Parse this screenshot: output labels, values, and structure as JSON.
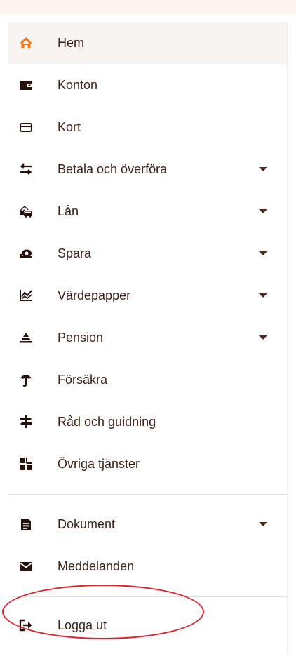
{
  "menu": {
    "items": [
      {
        "label": "Hem",
        "icon": "home-icon",
        "active": true,
        "expandable": false
      },
      {
        "label": "Konton",
        "icon": "wallet-icon",
        "active": false,
        "expandable": false
      },
      {
        "label": "Kort",
        "icon": "card-icon",
        "active": false,
        "expandable": false
      },
      {
        "label": "Betala och överföra",
        "icon": "transfer-arrows-icon",
        "active": false,
        "expandable": true
      },
      {
        "label": "Lån",
        "icon": "house-car-icon",
        "active": false,
        "expandable": true
      },
      {
        "label": "Spara",
        "icon": "piggy-bank-icon",
        "active": false,
        "expandable": true
      },
      {
        "label": "Värdepapper",
        "icon": "chart-line-icon",
        "active": false,
        "expandable": true
      },
      {
        "label": "Pension",
        "icon": "pyramid-icon",
        "active": false,
        "expandable": true
      },
      {
        "label": "Försäkra",
        "icon": "umbrella-icon",
        "active": false,
        "expandable": false
      },
      {
        "label": "Råd och guidning",
        "icon": "signpost-icon",
        "active": false,
        "expandable": false
      },
      {
        "label": "Övriga tjänster",
        "icon": "grid-icon",
        "active": false,
        "expandable": false
      }
    ],
    "secondary": [
      {
        "label": "Dokument",
        "icon": "document-icon",
        "expandable": true
      },
      {
        "label": "Meddelanden",
        "icon": "envelope-icon",
        "expandable": false
      }
    ],
    "logout": {
      "label": "Logga ut",
      "icon": "logout-icon"
    }
  },
  "colors": {
    "accent": "#f0781e",
    "text": "#3b1f14",
    "icon": "#26120a",
    "active_bg": "#f7f4f1",
    "annotation_circle": "#e1202a"
  }
}
